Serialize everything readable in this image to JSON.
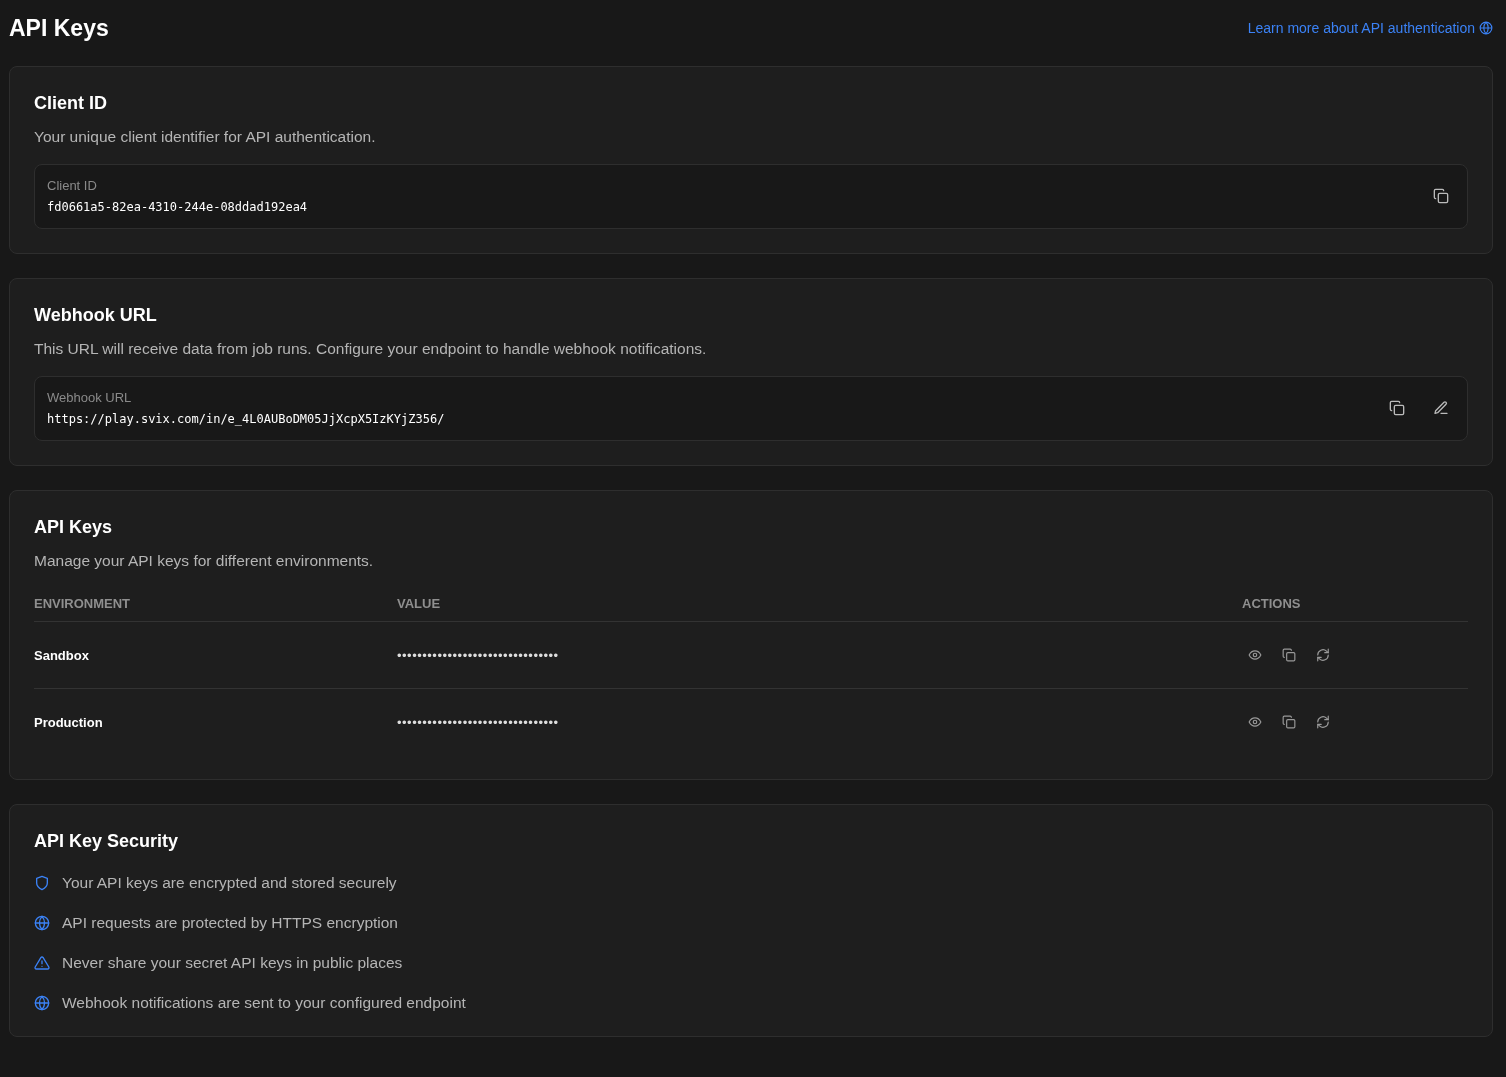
{
  "page": {
    "title": "API Keys",
    "help_link": "Learn more about API authentication"
  },
  "client_id": {
    "title": "Client ID",
    "description": "Your unique client identifier for API authentication.",
    "field": {
      "label": "Client ID",
      "value": "fd0661a5-82ea-4310-244e-08ddad192ea4",
      "actions": [
        {
          "kind": "copy"
        }
      ]
    }
  },
  "webhook": {
    "title": "Webhook URL",
    "description": "This URL will receive data from job runs. Configure your endpoint to handle webhook notifications.",
    "field": {
      "label": "Webhook URL",
      "value": "https://play.svix.com/in/e_4L0AUBoDM05JjXcpX5IzKYjZ356/",
      "actions": [
        {
          "kind": "copy"
        },
        {
          "kind": "edit"
        }
      ]
    }
  },
  "api_keys": {
    "title": "API Keys",
    "description": "Manage your API keys for different environments.",
    "table": {
      "columns": [
        "ENVIRONMENT",
        "VALUE",
        "ACTIONS"
      ],
      "rows": [
        {
          "environment": "Sandbox",
          "value": "••••••••••••••••••••••••••••••••",
          "actions": [
            {
              "kind": "view"
            },
            {
              "kind": "copy"
            },
            {
              "kind": "regenerate"
            }
          ]
        },
        {
          "environment": "Production",
          "value": "••••••••••••••••••••••••••••••••",
          "actions": [
            {
              "kind": "view"
            },
            {
              "kind": "copy"
            },
            {
              "kind": "regenerate"
            }
          ]
        }
      ]
    }
  },
  "security": {
    "title": "API Key Security",
    "items": [
      {
        "kind": "shield",
        "text": "Your API keys are encrypted and stored securely"
      },
      {
        "kind": "globe",
        "text": "API requests are protected by HTTPS encryption"
      },
      {
        "kind": "warning",
        "text": "Never share your secret API keys in public places"
      },
      {
        "kind": "globe",
        "text": "Webhook notifications are sent to your configured endpoint"
      }
    ]
  }
}
